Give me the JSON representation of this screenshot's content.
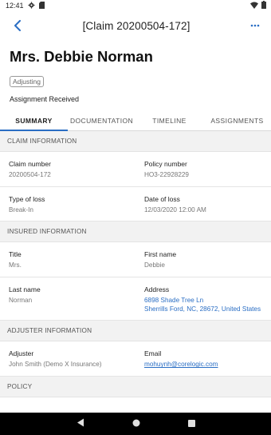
{
  "status_bar": {
    "time": "12:41"
  },
  "app_bar": {
    "title": "[Claim 20200504-172]"
  },
  "header": {
    "name": "Mrs. Debbie Norman",
    "badge": "Adjusting",
    "assignment_status": "Assignment Received"
  },
  "tabs": [
    "SUMMARY",
    "DOCUMENTATION",
    "TIMELINE",
    "ASSIGNMENTS"
  ],
  "sections": {
    "claim": {
      "title": "CLAIM INFORMATION",
      "claim_number_label": "Claim number",
      "claim_number": "20200504-172",
      "policy_number_label": "Policy number",
      "policy_number": "HO3-22928229",
      "type_of_loss_label": "Type of loss",
      "type_of_loss": "Break-In",
      "date_of_loss_label": "Date of loss",
      "date_of_loss": "12/03/2020 12:00 AM"
    },
    "insured": {
      "title": "INSURED INFORMATION",
      "title_label": "Title",
      "title_value": "Mrs.",
      "first_name_label": "First name",
      "first_name": "Debbie",
      "last_name_label": "Last name",
      "last_name": "Norman",
      "address_label": "Address",
      "address_line1": "6898 Shade Tree Ln",
      "address_line2": "Sherrills Ford, NC, 28672, United States"
    },
    "adjuster": {
      "title": "ADJUSTER INFORMATION",
      "adjuster_label": "Adjuster",
      "adjuster": "John Smith (Demo X Insurance)",
      "email_label": "Email",
      "email": "mohuynh@corelogic.com"
    },
    "policy": {
      "title": "POLICY"
    }
  },
  "colors": {
    "accent": "#2a6ec4",
    "section_bg": "#f2f2f2",
    "nav_bg": "#000000"
  }
}
